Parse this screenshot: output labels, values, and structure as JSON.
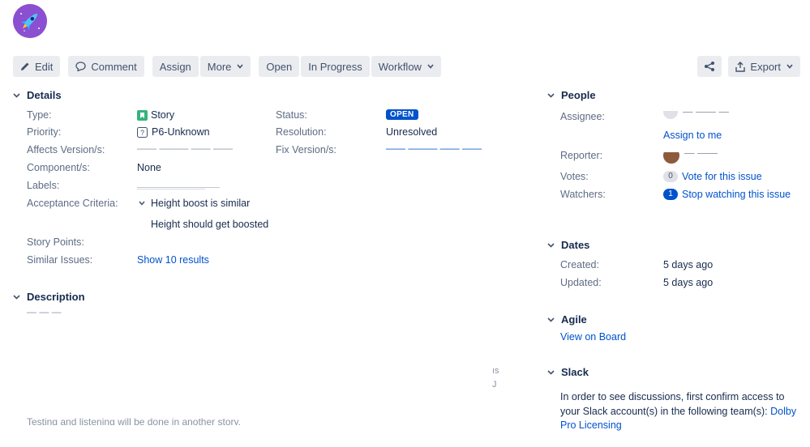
{
  "header": {
    "title_fragment": "— — — — — — — — — —"
  },
  "toolbar": {
    "edit": "Edit",
    "comment": "Comment",
    "assign": "Assign",
    "more": "More",
    "open": "Open",
    "in_progress": "In Progress",
    "workflow": "Workflow",
    "export": "Export"
  },
  "details": {
    "heading": "Details",
    "type_label": "Type:",
    "type_value": "Story",
    "priority_label": "Priority:",
    "priority_value": "P6-Unknown",
    "affects_label": "Affects Version/s:",
    "affects_value": "—— ——— —— ——",
    "component_label": "Component/s:",
    "component_value": "None",
    "labels_label": "Labels:",
    "labels_value": "———————",
    "acceptance_label": "Acceptance Criteria:",
    "acceptance_heading": "Height boost is similar",
    "acceptance_body": "Height should get boosted",
    "story_points_label": "Story Points:",
    "similar_label": "Similar Issues:",
    "similar_value": "Show 10 results",
    "status_label": "Status:",
    "status_value": "OPEN",
    "resolution_label": "Resolution:",
    "resolution_value": "Unresolved",
    "fix_label": "Fix Version/s:",
    "fix_value": "—— ——— —— ——"
  },
  "description": {
    "heading": "Description",
    "line1": "— — —",
    "frag_right1": "ıs",
    "frag_right2": "J",
    "last_line": "Testing and listening will be done in another story."
  },
  "people": {
    "heading": "People",
    "assignee_label": "Assignee:",
    "assignee_value": "— —— —",
    "assign_to_me": "Assign to me",
    "reporter_label": "Reporter:",
    "reporter_value": "— ——",
    "votes_label": "Votes:",
    "votes_count": "0",
    "vote_link": "Vote for this issue",
    "watchers_label": "Watchers:",
    "watchers_count": "1",
    "watch_link": "Stop watching this issue"
  },
  "dates": {
    "heading": "Dates",
    "created_label": "Created:",
    "created_value": "5 days ago",
    "updated_label": "Updated:",
    "updated_value": "5 days ago"
  },
  "agile": {
    "heading": "Agile",
    "view_board": "View on Board"
  },
  "slack": {
    "heading": "Slack",
    "text": "In order to see discussions, first confirm access to your Slack account(s) in the following team(s): ",
    "team_link": "Dolby Pro Licensing"
  },
  "colors": {
    "accent": "#0052cc",
    "button_bg": "#ebecf0",
    "label": "#5e6c84",
    "story_icon": "#36b37e",
    "avatar_bg": "#8b4fd1"
  },
  "icons": [
    "rocket-icon",
    "pencil-icon",
    "comment-icon",
    "chevron-down-icon",
    "share-icon",
    "export-icon",
    "story-icon",
    "priority-unknown-icon",
    "user-avatar-icon"
  ]
}
